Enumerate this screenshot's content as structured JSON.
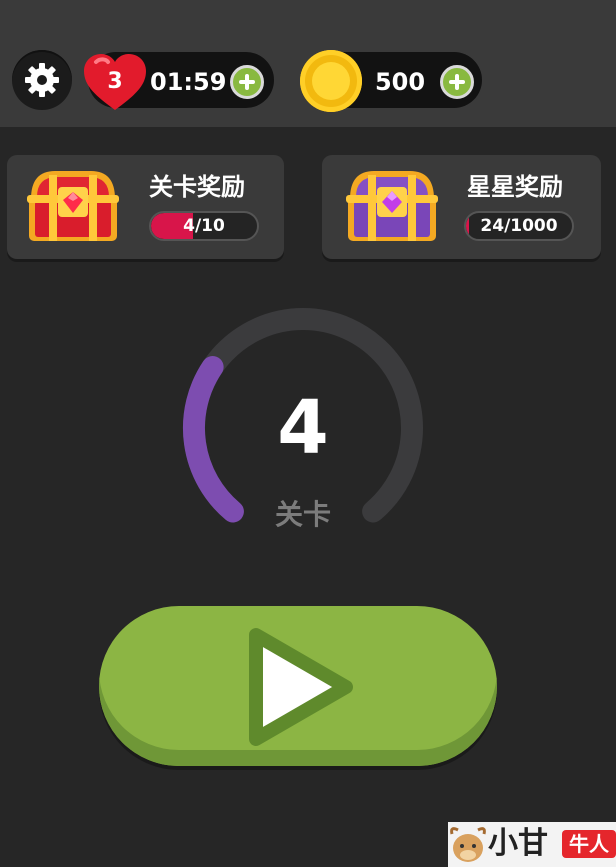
{
  "header": {
    "lives": "3",
    "timer": "01:59",
    "coins": "500"
  },
  "rewards": {
    "level": {
      "title": "关卡奖励",
      "progress_text": "4/10",
      "progress": 0.4
    },
    "stars": {
      "title": "星星奖励",
      "progress_text": "24/1000",
      "progress": 0.024
    }
  },
  "level": {
    "number": "4",
    "label": "关卡",
    "progress": 0.3
  },
  "watermark": {
    "text": "小甘",
    "tag": "牛人"
  },
  "colors": {
    "accent_green": "#8cb544",
    "ring_purple": "#7d4db0",
    "progress_red": "#d8154a",
    "coin_gold": "#f2b90f",
    "heart_red": "#e21b2c"
  },
  "icons": [
    "gear-icon",
    "heart-icon",
    "plus-icon",
    "coin-icon",
    "red-chest-icon",
    "purple-chest-icon",
    "play-icon"
  ]
}
